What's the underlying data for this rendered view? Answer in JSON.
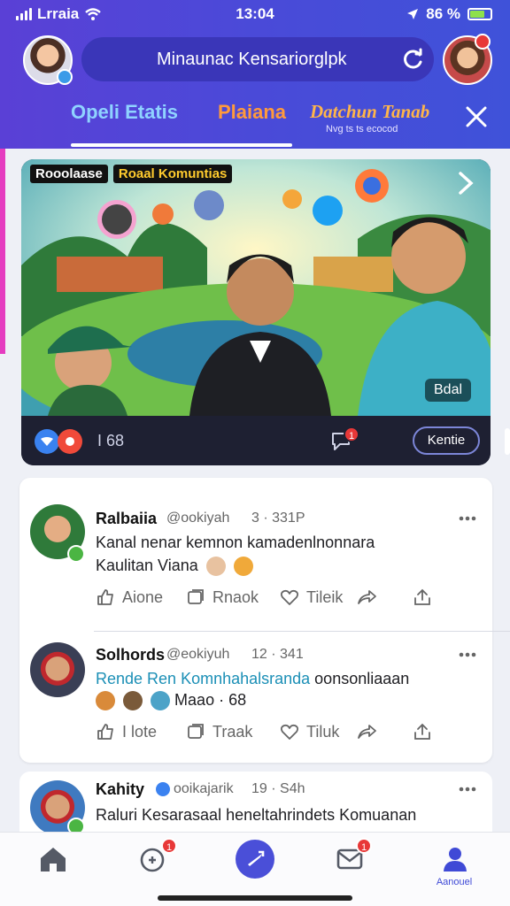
{
  "status_bar": {
    "carrier": "Lrraia",
    "time": "13:04",
    "battery": "86 %"
  },
  "header": {
    "search_placeholder": "Minaunac Kensariorglpk",
    "tabs": [
      {
        "label": "Opeli Etatis"
      },
      {
        "label": "Plaiana"
      },
      {
        "label": "Datchun Tanab",
        "sublabel": "Nvg ts ts ecocod"
      }
    ]
  },
  "feature": {
    "tags": [
      "Rooolaase",
      "Roaal Komuntias"
    ],
    "count_badge": "Bdal",
    "views": "I 68",
    "button_label": "Kentie",
    "comment_badge": "1"
  },
  "posts": [
    {
      "name": "Ralbaiia",
      "handle": "@ookiyah",
      "time": "3 · 331P",
      "text_line1": "Kanal  nenar  kemnon  kamadenlnonnara",
      "text_line2": "Kaulitan Viana",
      "actions": [
        "Aione",
        "Rnaok",
        "Tileik"
      ]
    },
    {
      "name": "Solhords",
      "handle": "@eokiyuh",
      "time": "12 · 341",
      "text_link": "Rende Ren Komnhahalsranda",
      "text_after": " oonsonliaaan",
      "text_line2": "Maao · 68",
      "actions": [
        "I lote",
        "Traak",
        "Tiluk"
      ]
    },
    {
      "name": "Kahity",
      "handle": "ooikajarik",
      "time": "19 · S4h",
      "text_line1": "Raluri Kesarasaal heneltahrindets Komuanan"
    }
  ],
  "bottom_nav": {
    "badges": [
      "1",
      "1"
    ],
    "profile_label": "Aanouel"
  },
  "colors": {
    "header": "#4a4ad8",
    "accent": "#3f4ad6",
    "link": "#1b8fb6",
    "badge": "#e83838"
  }
}
